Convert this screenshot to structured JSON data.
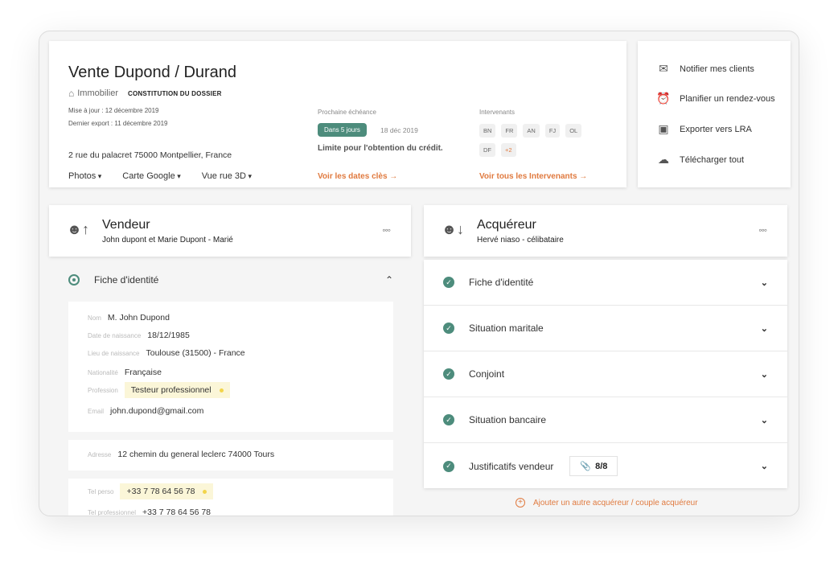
{
  "header": {
    "title": "Vente Dupond / Durand",
    "category": "Immobilier",
    "stage": "CONSTITUTION DU DOSSIER",
    "updated": "Mise à jour : 12 décembre 2019",
    "exported": "Dernier export : 11 décembre 2019",
    "address": "2 rue du palacret 75000 Montpellier, France",
    "links": [
      "Photos",
      "Carte Google",
      "Vue rue 3D"
    ]
  },
  "deadline": {
    "label": "Prochaine échéance",
    "pill": "Dans 5 jours",
    "date": "18 déc 2019",
    "description": "Limite pour l'obtention du crédit.",
    "link": "Voir les dates clès →"
  },
  "intervenants": {
    "label": "Intervenants",
    "chips": [
      "BN",
      "FR",
      "AN",
      "FJ",
      "OL",
      "DF"
    ],
    "more": "+2",
    "link": "Voir tous les Intervenants →"
  },
  "actions": [
    {
      "label": "Notifier mes clients",
      "icon": "mail-fast-icon"
    },
    {
      "label": "Planifier un rendez-vous",
      "icon": "alarm-clock-icon"
    },
    {
      "label": "Exporter vers LRA",
      "icon": "export-icon"
    },
    {
      "label": "Télécharger tout",
      "icon": "cloud-download-icon"
    }
  ],
  "vendeur": {
    "title": "Vendeur",
    "subtitle": "John dupont et Marie Dupont -  Marié",
    "fiche_label": "Fiche d'identité",
    "fields": [
      {
        "key": "Nom",
        "value": "M. John Dupond"
      },
      {
        "key": "Date de naissance",
        "value": "18/12/1985"
      },
      {
        "key": "Lieu de naissance",
        "value": "Toulouse (31500) - France"
      },
      {
        "key": "Nationalité",
        "value": "Française"
      },
      {
        "key": "Profession",
        "value": "Testeur professionnel"
      },
      {
        "key": "Email",
        "value": "john.dupond@gmail.com"
      }
    ],
    "address_key": "Adresse",
    "address_value": "12 chemin du general leclerc 74000 Tours",
    "phones": [
      {
        "key": "Tel perso",
        "value": "+33 7 78 64 56 78"
      },
      {
        "key": "Tel professionnel",
        "value": "+33 7 78 64 56 78"
      }
    ]
  },
  "acquereur": {
    "title": "Acquéreur",
    "subtitle": "Hervé niaso -  célibataire",
    "sections": [
      "Fiche d'identité",
      "Situation maritale",
      "Conjoint",
      "Situation bancaire",
      "Justificatifs vendeur"
    ],
    "justificatifs_count": "8/8",
    "add_link": "Ajouter un autre acquéreur / couple acquéreur"
  },
  "colors": {
    "accent_green": "#4d8c7c",
    "accent_orange": "#e07a3f",
    "highlight": "#fbf6d8"
  }
}
